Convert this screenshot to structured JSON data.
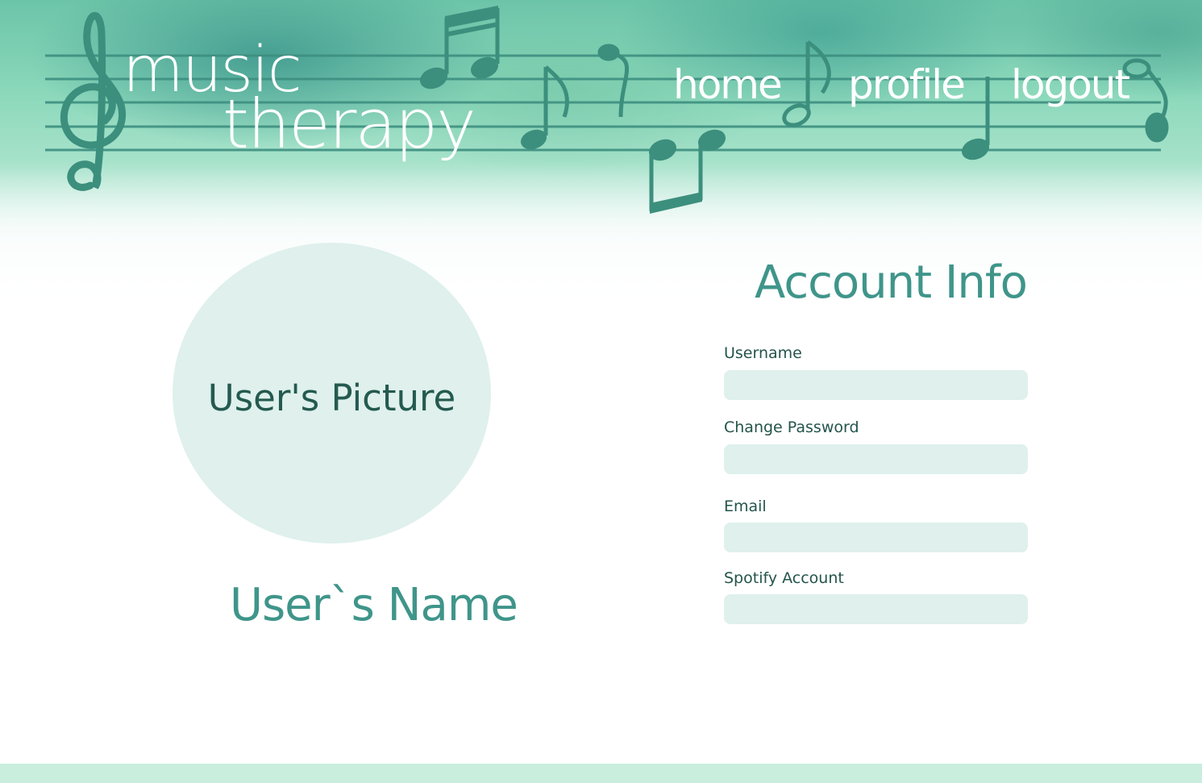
{
  "colors": {
    "accent": "#3f958a",
    "staff_line": "#3d8f80",
    "note": "#3c8f7d",
    "input_bg": "#dff0ed",
    "label_text": "#24544b",
    "footer_bar": "#c9eedd"
  },
  "header": {
    "logo": {
      "line1": "music",
      "line2": "therapy"
    },
    "nav": {
      "home": "home",
      "profile": "profile",
      "logout": "logout"
    }
  },
  "profile": {
    "picture_label": "User's Picture",
    "name": "User`s Name"
  },
  "account": {
    "title": "Account Info",
    "fields": {
      "username": {
        "label": "Username",
        "value": "",
        "placeholder": ""
      },
      "password": {
        "label": "Change Password",
        "value": "",
        "placeholder": ""
      },
      "email": {
        "label": "Email",
        "value": "",
        "placeholder": ""
      },
      "spotify": {
        "label": "Spotify Account",
        "value": "",
        "placeholder": ""
      }
    }
  },
  "icons": {
    "clef": "treble-clef-icon",
    "notes": "music-note-icon"
  }
}
